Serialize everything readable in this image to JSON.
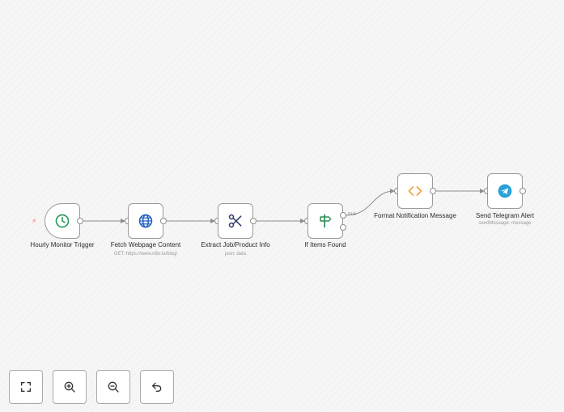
{
  "nodes": {
    "trigger": {
      "label": "Hourly Monitor Trigger",
      "subtitle": "",
      "icon": "clock-icon",
      "color": "#2e9b5f"
    },
    "fetch": {
      "label": "Fetch Webpage Content",
      "subtitle": "GET: https://www.n8n.io/blog/",
      "icon": "globe-icon",
      "color": "#1f5fbf"
    },
    "extract": {
      "label": "Extract Job/Product Info",
      "subtitle": "json: data",
      "icon": "scissors-icon",
      "color": "#2b3a67"
    },
    "if": {
      "label": "If Items Found",
      "subtitle": "",
      "icon": "signpost-icon",
      "color": "#2e8b57",
      "true_label": "true"
    },
    "format": {
      "label": "Format Notification Message",
      "subtitle": "",
      "icon": "code-icon",
      "color": "#f0a23a"
    },
    "telegram": {
      "label": "Send Telegram Alert",
      "subtitle": "sendMessage: message",
      "icon": "telegram-icon",
      "color": "#2aa1d9"
    }
  },
  "controls": [
    {
      "name": "fit-view-button",
      "icon": "fit-view-icon"
    },
    {
      "name": "zoom-in-button",
      "icon": "zoom-in-icon"
    },
    {
      "name": "zoom-out-button",
      "icon": "zoom-out-icon"
    },
    {
      "name": "undo-button",
      "icon": "undo-icon"
    }
  ],
  "colors": {
    "edge": "#8c8c8c",
    "trigger_bolt": "#ff6d5a"
  }
}
